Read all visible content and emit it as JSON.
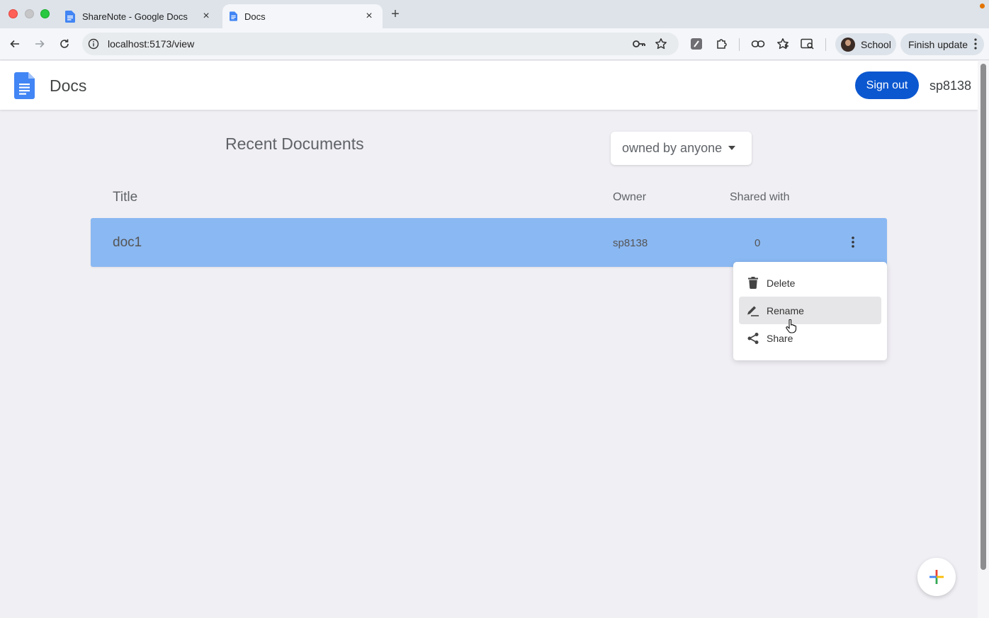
{
  "browser": {
    "tabs": [
      {
        "title": "ShareNote - Google Docs",
        "active": false
      },
      {
        "title": "Docs",
        "active": true
      }
    ],
    "url": "localhost:5173/view",
    "profile_name": "School",
    "update_label": "Finish update",
    "colors": {
      "update_dot": "#e37400"
    }
  },
  "app": {
    "title": "Docs",
    "signout_label": "Sign out",
    "username": "sp8138",
    "accent": "#0b57d0"
  },
  "documents": {
    "heading": "Recent Documents",
    "filter": {
      "selected": "owned by anyone"
    },
    "columns": {
      "title": "Title",
      "owner": "Owner",
      "shared": "Shared with"
    },
    "rows": [
      {
        "title": "doc1",
        "owner": "sp8138",
        "shared_with": "0",
        "selected": true
      }
    ],
    "row_color": "#8ab8f2"
  },
  "context_menu": {
    "items": [
      {
        "label": "Delete",
        "icon": "trash-icon"
      },
      {
        "label": "Rename",
        "icon": "pencil-icon",
        "hovered": true
      },
      {
        "label": "Share",
        "icon": "share-icon"
      }
    ]
  },
  "fab": {
    "icon": "plus-icon"
  }
}
